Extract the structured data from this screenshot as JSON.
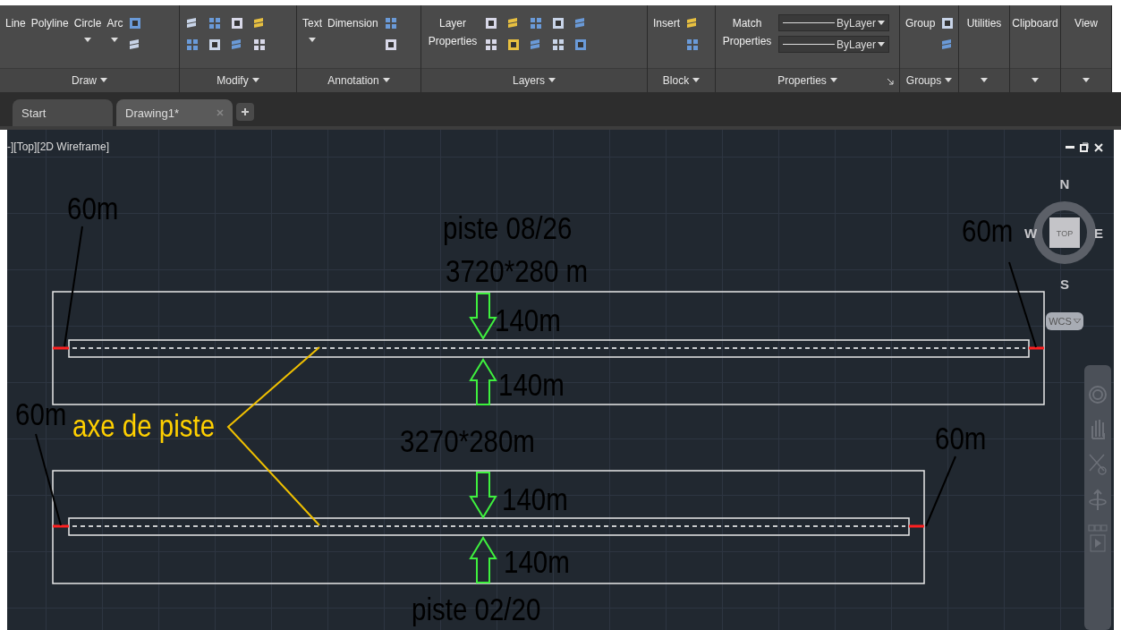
{
  "ribbon": {
    "panels": [
      {
        "title": "Draw",
        "tools": [
          {
            "label": "Line",
            "dropdown": false
          },
          {
            "label": "Polyline",
            "dropdown": false
          },
          {
            "label": "Circle",
            "dropdown": true
          },
          {
            "label": "Arc",
            "dropdown": true
          }
        ]
      },
      {
        "title": "Modify"
      },
      {
        "title": "Annotation",
        "tools": [
          {
            "label": "Text",
            "dropdown": true
          },
          {
            "label": "Dimension",
            "dropdown": false
          }
        ]
      },
      {
        "title": "Layers",
        "tools": [
          {
            "label": "Layer Properties",
            "dropdown": false
          }
        ]
      },
      {
        "title": "Block",
        "tools": [
          {
            "label": "Insert",
            "dropdown": false
          }
        ]
      },
      {
        "title": "Properties",
        "tools": [
          {
            "label": "Match Properties",
            "dropdown": false
          }
        ],
        "dropdowns": [
          "ByLayer",
          "ByLayer"
        ]
      },
      {
        "title": "Groups",
        "tools": [
          {
            "label": "Group",
            "dropdown": false
          }
        ]
      }
    ],
    "collapsed": [
      "Utilities",
      "Clipboard",
      "View"
    ]
  },
  "tabs": [
    {
      "label": "Start",
      "selected": false
    },
    {
      "label": "Drawing1*",
      "selected": true
    }
  ],
  "viewport": {
    "label": "-][Top][2D Wireframe]",
    "viewcube": {
      "face": "TOP",
      "north": "N",
      "south": "S",
      "east": "E",
      "west": "W",
      "ucs": "WCS"
    },
    "drawing": {
      "runways": [
        {
          "name": "piste 08/26",
          "size": "3720*280 m",
          "offset_top": "140m",
          "offset_bottom": "140m",
          "end_left": "60m",
          "end_right": "60m"
        },
        {
          "name": "piste 02/20",
          "size": "3270*280m",
          "offset_top": "140m",
          "offset_bottom": "140m",
          "end_left": "60m",
          "end_right": "60m"
        }
      ],
      "axis_label": "axe de piste"
    }
  }
}
